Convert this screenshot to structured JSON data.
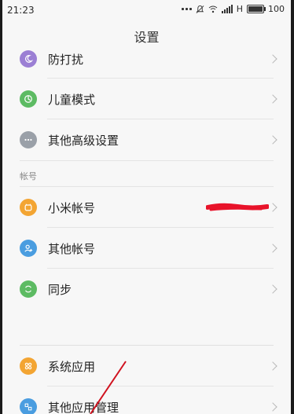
{
  "status_bar": {
    "time": "21:23",
    "network": "H",
    "battery": "100"
  },
  "header": {
    "title": "设置"
  },
  "groups": [
    {
      "items": [
        {
          "label": "防打扰",
          "icon": "moon-icon",
          "color": "#9b7fd4"
        },
        {
          "label": "儿童模式",
          "icon": "kid-icon",
          "color": "#5dbb63"
        },
        {
          "label": "其他高级设置",
          "icon": "more-icon",
          "color": "#9aa0a8"
        }
      ]
    },
    {
      "header": "帐号",
      "items": [
        {
          "label": "小米帐号",
          "icon": "mi-account-icon",
          "color": "#f3a533"
        },
        {
          "label": "其他帐号",
          "icon": "user-add-icon",
          "color": "#4a9de0"
        },
        {
          "label": "同步",
          "icon": "sync-icon",
          "color": "#5dbb63"
        }
      ]
    },
    {
      "items": [
        {
          "label": "系统应用",
          "icon": "apps-icon",
          "color": "#f3a533"
        },
        {
          "label": "其他应用管理",
          "icon": "app-manage-icon",
          "color": "#4a9de0"
        }
      ]
    }
  ]
}
